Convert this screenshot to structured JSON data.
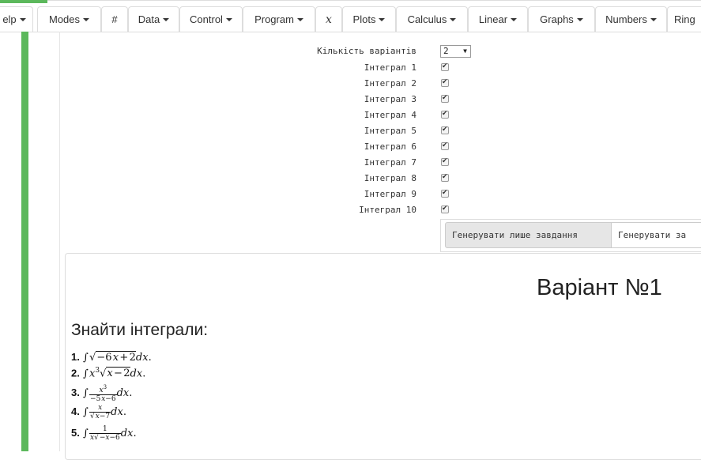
{
  "toolbar": {
    "items": [
      {
        "label": "elp",
        "caret": true
      },
      {
        "label": "Modes",
        "caret": true
      },
      {
        "label": "#",
        "caret": false
      },
      {
        "label": "Data",
        "caret": true
      },
      {
        "label": "Control",
        "caret": true
      },
      {
        "label": "Program",
        "caret": true
      },
      {
        "label": "x",
        "caret": false,
        "math": true
      },
      {
        "label": "Plots",
        "caret": true
      },
      {
        "label": "Calculus",
        "caret": true
      },
      {
        "label": "Linear",
        "caret": true
      },
      {
        "label": "Graphs",
        "caret": true
      },
      {
        "label": "Numbers",
        "caret": true
      },
      {
        "label": "Ring",
        "caret": false
      }
    ]
  },
  "form": {
    "variants_label": "Кількість варіантів",
    "variants_value": "2",
    "integrals": [
      {
        "label": "Інтеграл 1",
        "checked": true
      },
      {
        "label": "Інтеграл 2",
        "checked": true
      },
      {
        "label": "Інтеграл 3",
        "checked": true
      },
      {
        "label": "Інтеграл 4",
        "checked": true
      },
      {
        "label": "Інтеграл 5",
        "checked": true
      },
      {
        "label": "Інтеграл 6",
        "checked": true
      },
      {
        "label": "Інтеграл 7",
        "checked": true
      },
      {
        "label": "Інтеграл 8",
        "checked": true
      },
      {
        "label": "Інтеграл 9",
        "checked": true
      },
      {
        "label": "Інтеграл 10",
        "checked": true
      }
    ],
    "btn_tasks_only": "Генерувати лише завдання",
    "btn_with_answers": "Генерувати за"
  },
  "output": {
    "variant_title": "Варіант №1",
    "task_heading": "Знайти інтеграли:",
    "problems": [
      "1.",
      "2.",
      "3.",
      "4.",
      "5."
    ]
  },
  "colors": {
    "accent": "#5cb85c"
  }
}
